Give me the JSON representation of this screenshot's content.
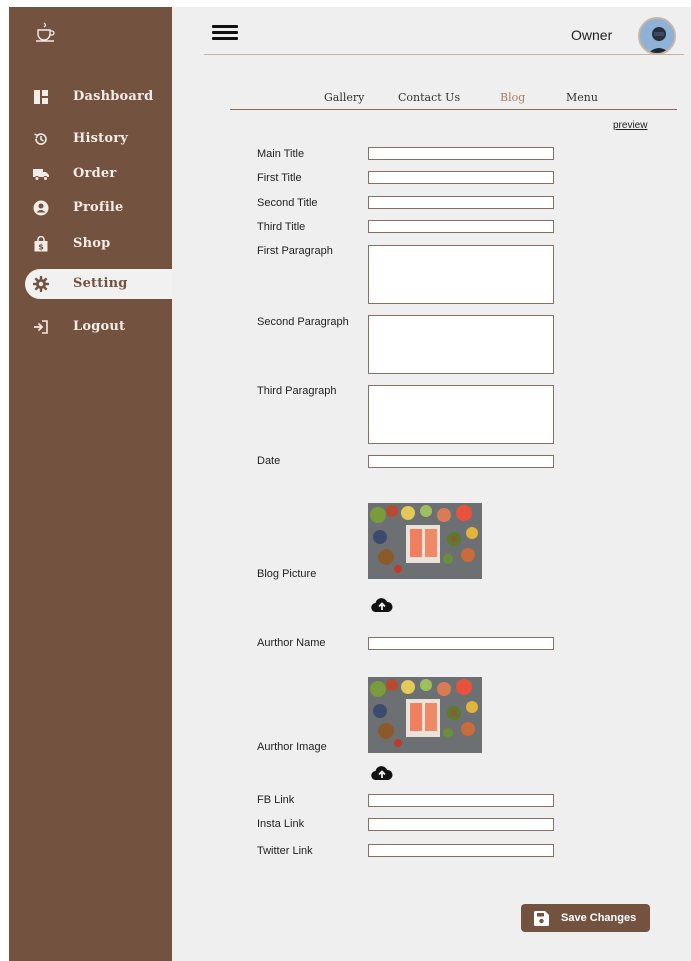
{
  "sidebar": {
    "items": [
      {
        "label": "Dashboard",
        "icon": "dashboard-icon"
      },
      {
        "label": "History",
        "icon": "history-icon"
      },
      {
        "label": "Order",
        "icon": "truck-icon"
      },
      {
        "label": "Profile",
        "icon": "user-circle-icon"
      },
      {
        "label": "Shop",
        "icon": "shopping-bag-icon"
      },
      {
        "label": "Setting",
        "icon": "gear-icon",
        "active": true
      },
      {
        "label": "Logout",
        "icon": "logout-icon"
      }
    ]
  },
  "header": {
    "user_name": "Owner"
  },
  "tabs": [
    {
      "label": "Gallery"
    },
    {
      "label": "Contact Us"
    },
    {
      "label": "Blog",
      "active": true
    },
    {
      "label": "Menu"
    }
  ],
  "preview_label": "preview",
  "form": {
    "main_title": {
      "label": "Main Title",
      "value": ""
    },
    "first_title": {
      "label": "First Title",
      "value": ""
    },
    "second_title": {
      "label": "Second Title",
      "value": ""
    },
    "third_title": {
      "label": "Third Title",
      "value": ""
    },
    "first_paragraph": {
      "label": "First Paragraph",
      "value": ""
    },
    "second_paragraph": {
      "label": "Second Paragraph",
      "value": ""
    },
    "third_paragraph": {
      "label": "Third Paragraph",
      "value": ""
    },
    "date": {
      "label": "Date",
      "value": ""
    },
    "blog_picture": {
      "label": "Blog Picture"
    },
    "author_name": {
      "label": "Aurthor Name",
      "value": ""
    },
    "author_image": {
      "label": "Aurthor Image"
    },
    "fb_link": {
      "label": "FB Link",
      "value": ""
    },
    "insta_link": {
      "label": "Insta Link",
      "value": ""
    },
    "twitter_link": {
      "label": "Twitter Link",
      "value": ""
    }
  },
  "save_button": {
    "label": "Save Changes",
    "icon": "floppy-disk-icon"
  },
  "colors": {
    "brand": "#73523f",
    "panel_bg": "#efefef",
    "active_tab": "#a77c63",
    "input_border": "#8a7062"
  }
}
